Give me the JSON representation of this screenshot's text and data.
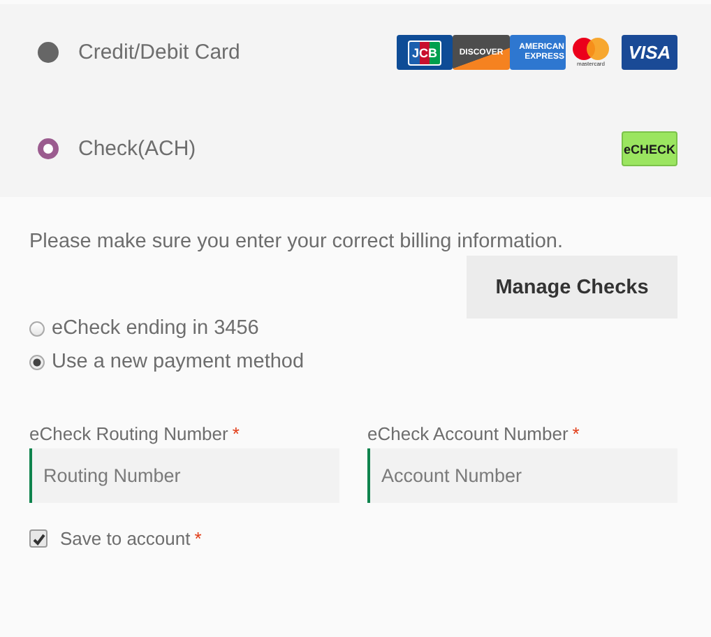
{
  "payment_methods": [
    {
      "label": "Credit/Debit Card",
      "selected": false,
      "logos": [
        {
          "kind": "jcb",
          "text": "JCB"
        },
        {
          "kind": "discover",
          "text": "DISCOVER"
        },
        {
          "kind": "amex",
          "text": "AMERICAN EXPRESS"
        },
        {
          "kind": "mastercard",
          "text": "mastercard"
        },
        {
          "kind": "visa",
          "text": "VISA"
        }
      ]
    },
    {
      "label": "Check(ACH)",
      "selected": true,
      "logos": [
        {
          "kind": "echeck",
          "text": "eCHECK"
        }
      ]
    }
  ],
  "notice": "Please make sure you enter your correct billing information.",
  "manage_button": "Manage Checks",
  "saved_options": [
    {
      "label": "eCheck ending in 3456",
      "selected": false
    },
    {
      "label": "Use a new payment method",
      "selected": true
    }
  ],
  "fields": [
    {
      "label": "eCheck Routing Number",
      "required_mark": "*",
      "placeholder": "Routing Number"
    },
    {
      "label": "eCheck Account Number",
      "required_mark": "*",
      "placeholder": "Account Number"
    }
  ],
  "save_to_account": {
    "label": "Save to account",
    "required_mark": "*",
    "checked": true
  }
}
